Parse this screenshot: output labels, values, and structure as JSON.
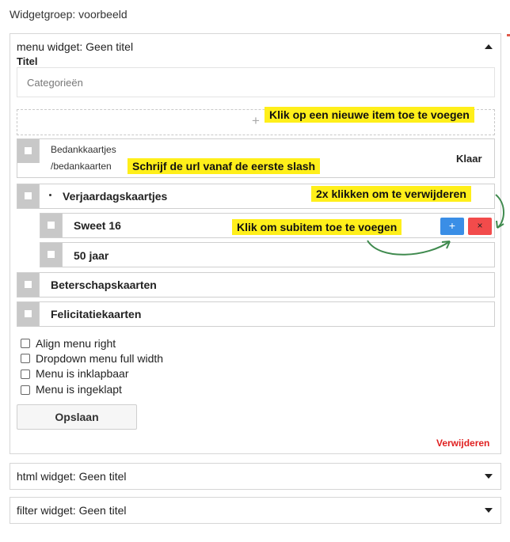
{
  "group_title": "Widgetgroep: voorbeeld",
  "menu_widget": {
    "header": "menu widget: Geen titel",
    "title_label": "Titel",
    "title_value": "Categorieën",
    "add_zone_icon": "plus-icon",
    "editing_item": {
      "title": "Bedankkaartjes",
      "url": "/bedankaarten",
      "done_label": "Klaar"
    },
    "items": [
      {
        "label": "Verjaardagskaartjes"
      },
      {
        "label": "Sweet 16"
      },
      {
        "label": "50 jaar"
      },
      {
        "label": "Beterschapskaarten"
      },
      {
        "label": "Felicitatiekaarten"
      }
    ],
    "add_subitem_button": "+",
    "remove_button": "×",
    "checkboxes": [
      {
        "label": "Align menu right",
        "checked": false
      },
      {
        "label": "Dropdown menu full width",
        "checked": false
      },
      {
        "label": "Menu is inklapbaar",
        "checked": false
      },
      {
        "label": "Menu is ingeklapt",
        "checked": false
      }
    ],
    "save_label": "Opslaan",
    "delete_label": "Verwijderen"
  },
  "callouts": {
    "add_item": "Klik op een nieuwe item toe te voegen",
    "url_hint": "Schrijf de url vanaf de eerste slash",
    "remove_hint": "2x klikken om te verwijderen",
    "subitem_hint": "Klik om subitem toe te voegen"
  },
  "other_widgets": [
    {
      "label": "html widget: Geen titel"
    },
    {
      "label": "filter widget: Geen titel"
    }
  ],
  "colors": {
    "callout_bg": "#ffef1a",
    "add_button": "#3a8ee6",
    "remove_button": "#f24b4b",
    "delete_link": "#e02020",
    "arrow": "#3f8a4e"
  }
}
